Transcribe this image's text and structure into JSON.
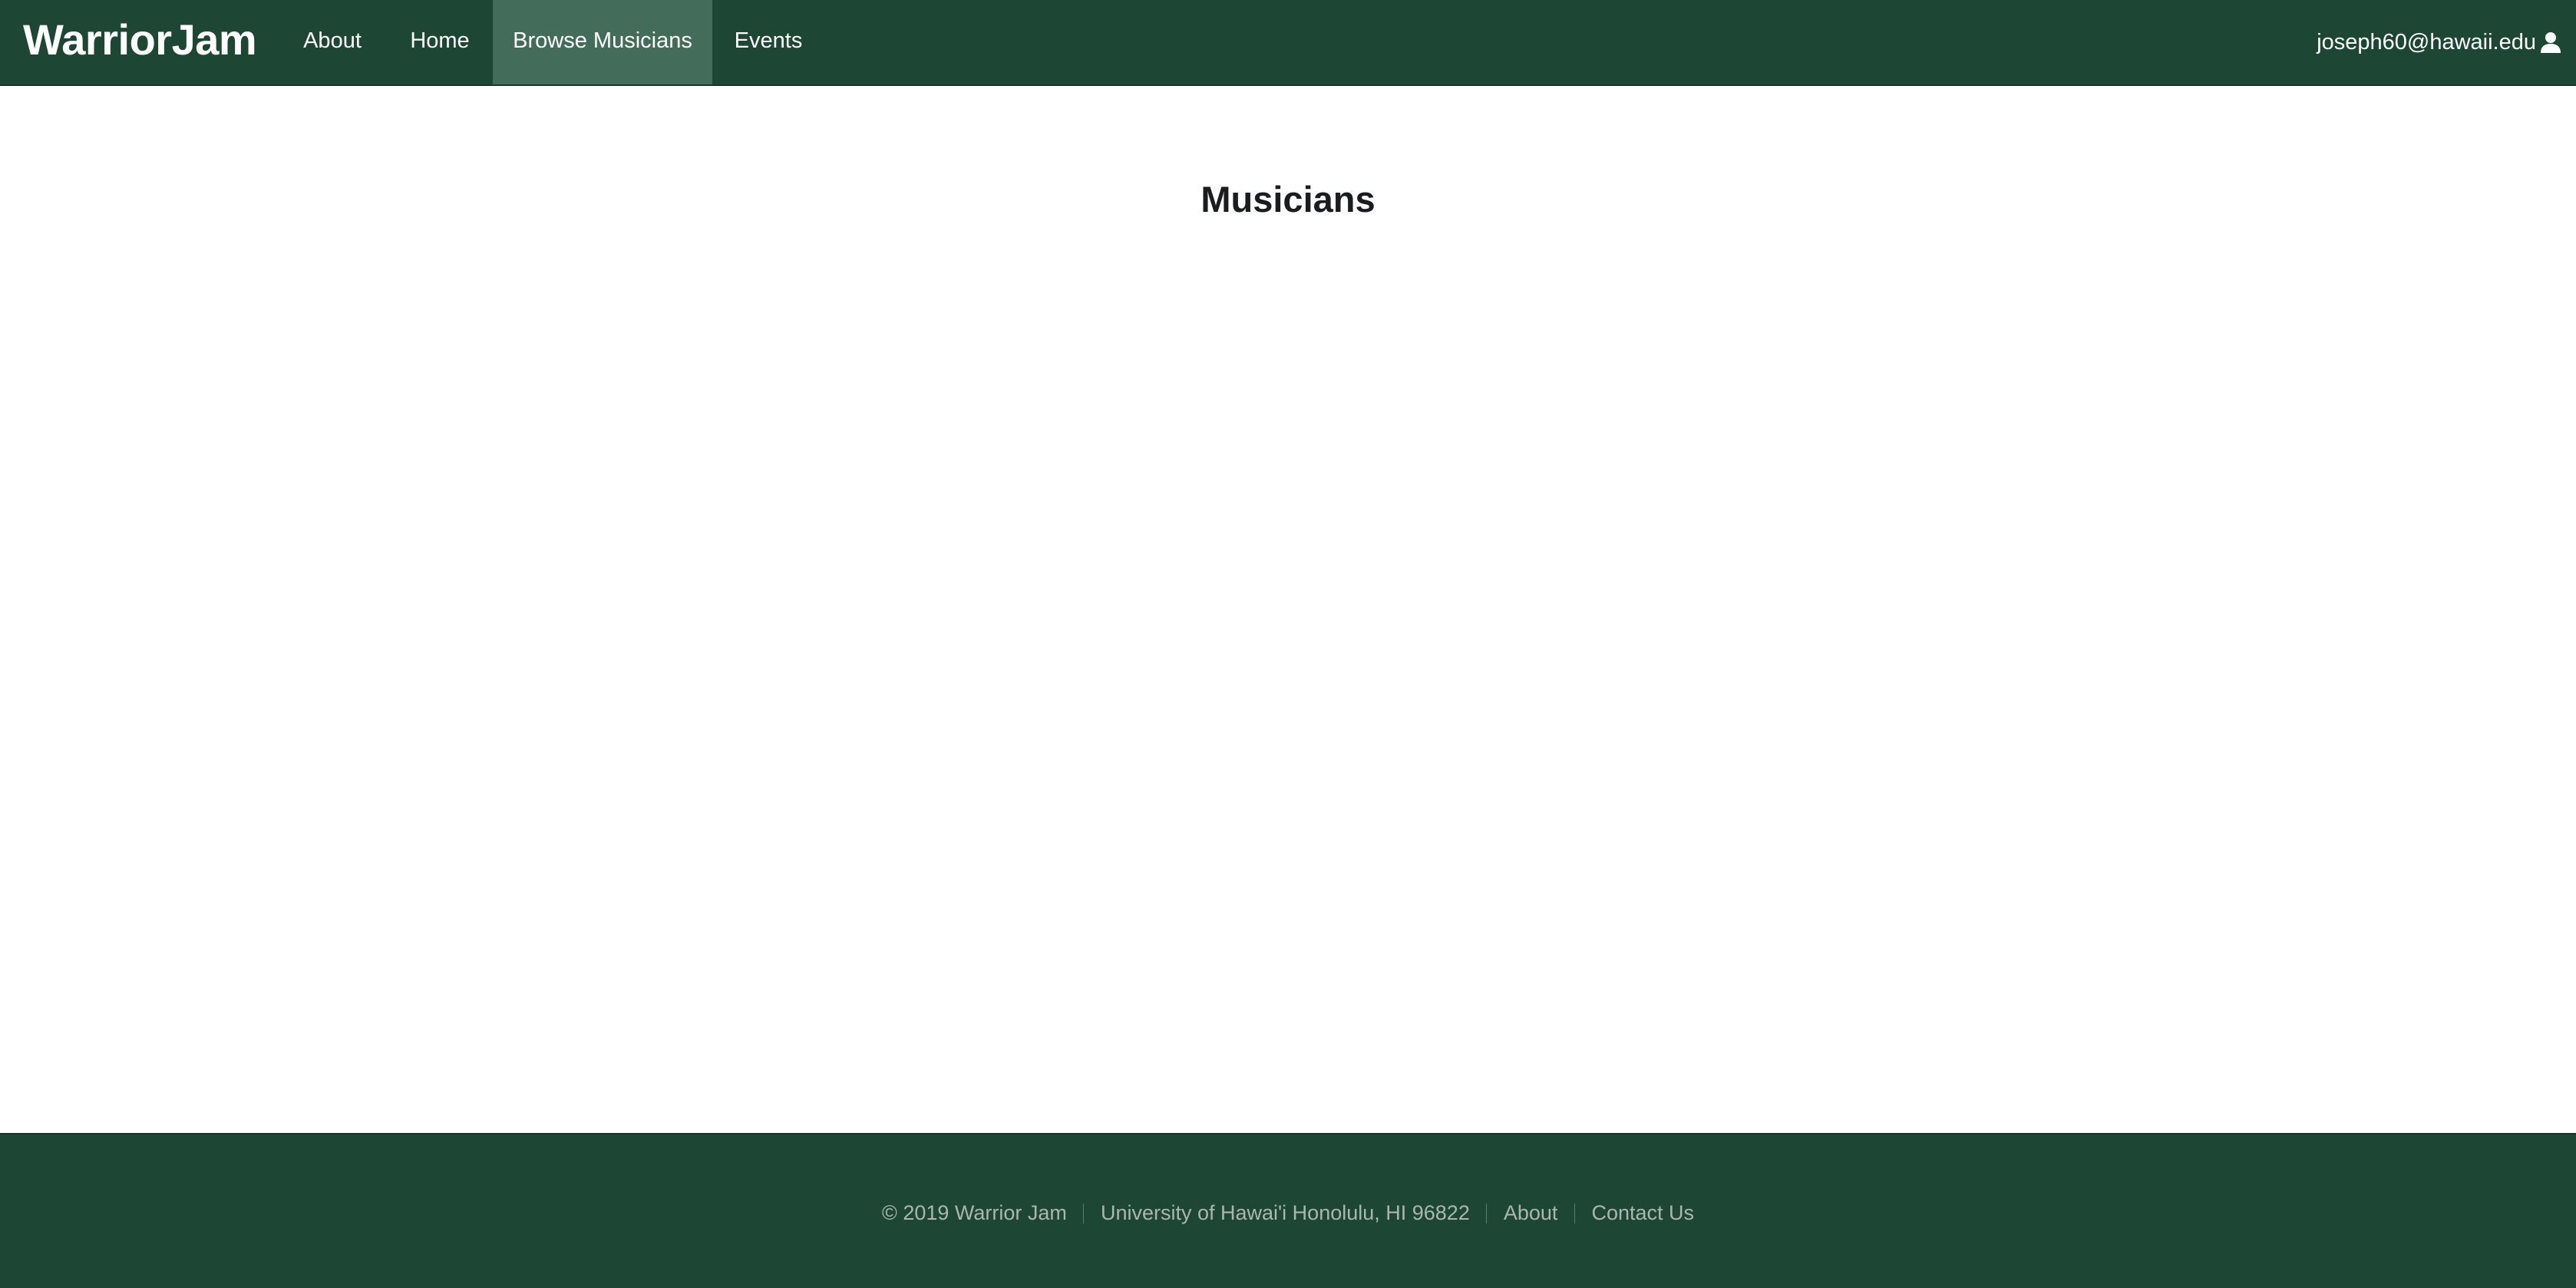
{
  "navbar": {
    "brand": "WarriorJam",
    "items": [
      {
        "label": "About"
      },
      {
        "label": "Home"
      },
      {
        "label": "Browse Musicians",
        "active": true
      },
      {
        "label": "Events"
      }
    ],
    "user_email": "joseph60@hawaii.edu",
    "user_icon": "user-icon"
  },
  "main": {
    "title": "Musicians"
  },
  "footer": {
    "copyright": "© 2019 Warrior Jam",
    "address": "University of Hawai'i Honolulu, HI 96822",
    "about_label": "About",
    "contact_label": "Contact Us"
  },
  "colors": {
    "navbar_bg": "#1e4635",
    "active_item_bg": "#436c5a",
    "footer_text": "#a9b7b0"
  }
}
